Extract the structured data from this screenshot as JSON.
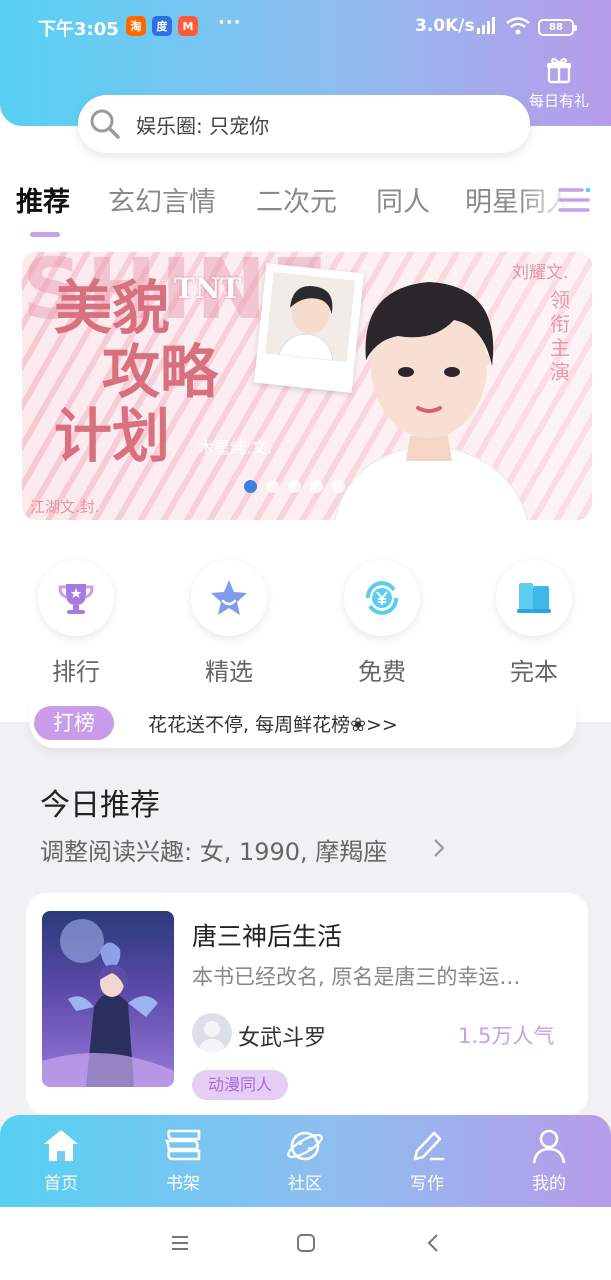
{
  "status_bar": {
    "time": "下午3:05",
    "more": "···",
    "speed": "3.0K/s",
    "battery": "88",
    "apps": [
      {
        "name": "taobao-app-icon",
        "glyph": "淘",
        "color": "#ff6a00"
      },
      {
        "name": "baidu-app-icon",
        "glyph": "度",
        "color": "#2f6fe6"
      },
      {
        "name": "shop-app-icon",
        "glyph": "M",
        "color": "#ff5a36"
      }
    ]
  },
  "header": {
    "gift_label": "每日有礼",
    "search_placeholder": "娱乐圈: 只宠你"
  },
  "tabs": [
    {
      "label": "推荐",
      "active": true
    },
    {
      "label": "玄幻言情",
      "active": false
    },
    {
      "label": "二次元",
      "active": false
    },
    {
      "label": "同人",
      "active": false
    },
    {
      "label": "明星同人",
      "active": false
    }
  ],
  "banner": {
    "title_line1": "美貌",
    "title_line2": "攻略",
    "title_line3": "计划",
    "watermark": "SHINE",
    "tag": "TNT",
    "caption_center": "木星纯.文.",
    "caption_bottom": "江湖文.封.",
    "caption_top_right": "刘耀文.",
    "caption_side": "领衔主演",
    "slide_count": 6,
    "active_slide": 0
  },
  "quick_links": [
    {
      "label": "排行",
      "icon": "trophy-icon"
    },
    {
      "label": "精选",
      "icon": "star-icon"
    },
    {
      "label": "免费",
      "icon": "free-yuan-icon"
    },
    {
      "label": "完本",
      "icon": "book-icon"
    }
  ],
  "promo": {
    "badge": "打榜",
    "text": "花花送不停, 每周鲜花榜❀>>"
  },
  "today": {
    "title": "今日推荐",
    "subtitle": "调整阅读兴趣: 女, 1990, 摩羯座"
  },
  "book": {
    "title": "唐三神后生活",
    "description": "本书已经改名, 原名是唐三的幸运…",
    "author": "女武斗罗",
    "popularity": "1.5万人气",
    "tag": "动漫同人"
  },
  "bottom_nav": [
    {
      "label": "首页",
      "icon": "home-icon"
    },
    {
      "label": "书架",
      "icon": "bookshelf-icon"
    },
    {
      "label": "社区",
      "icon": "community-planet-icon"
    },
    {
      "label": "写作",
      "icon": "write-pen-icon"
    },
    {
      "label": "我的",
      "icon": "profile-icon"
    }
  ],
  "colors": {
    "gradient_start": "#56d1f3",
    "gradient_end": "#b79be9",
    "accent_purple": "#c6a2ea",
    "dot_active": "#3a82e0"
  }
}
